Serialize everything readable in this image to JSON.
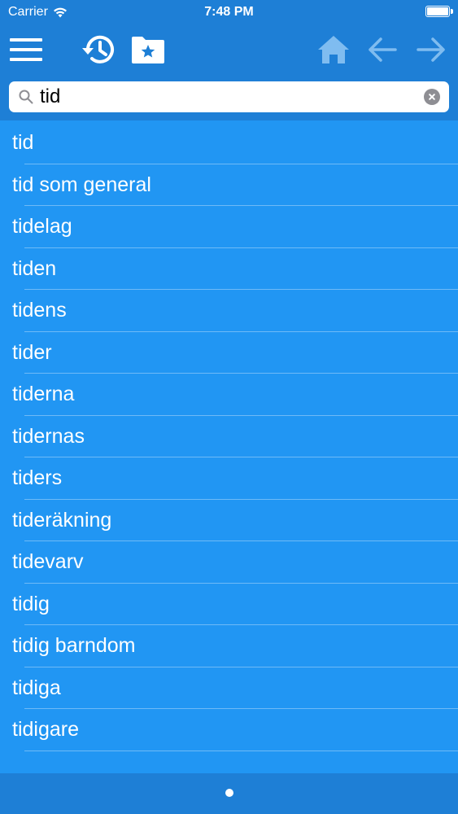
{
  "status_bar": {
    "carrier": "Carrier",
    "time": "7:48 PM"
  },
  "toolbar": {
    "icons": [
      "menu-icon",
      "history-icon",
      "favorites-folder-icon",
      "home-icon",
      "back-arrow-icon",
      "forward-arrow-icon"
    ]
  },
  "search": {
    "value": "tid",
    "placeholder": ""
  },
  "results": [
    "tid",
    "tid som general",
    "tidelag",
    "tiden",
    "tidens",
    "tider",
    "tiderna",
    "tidernas",
    "tiders",
    "tideräkning",
    "tidevarv",
    "tidig",
    "tidig barndom",
    "tidiga",
    "tidigare"
  ],
  "colors": {
    "background": "#2196F3",
    "bar": "#1E7FD6",
    "disabled_icon": "#7FBCF0",
    "text": "#FFFFFF"
  }
}
